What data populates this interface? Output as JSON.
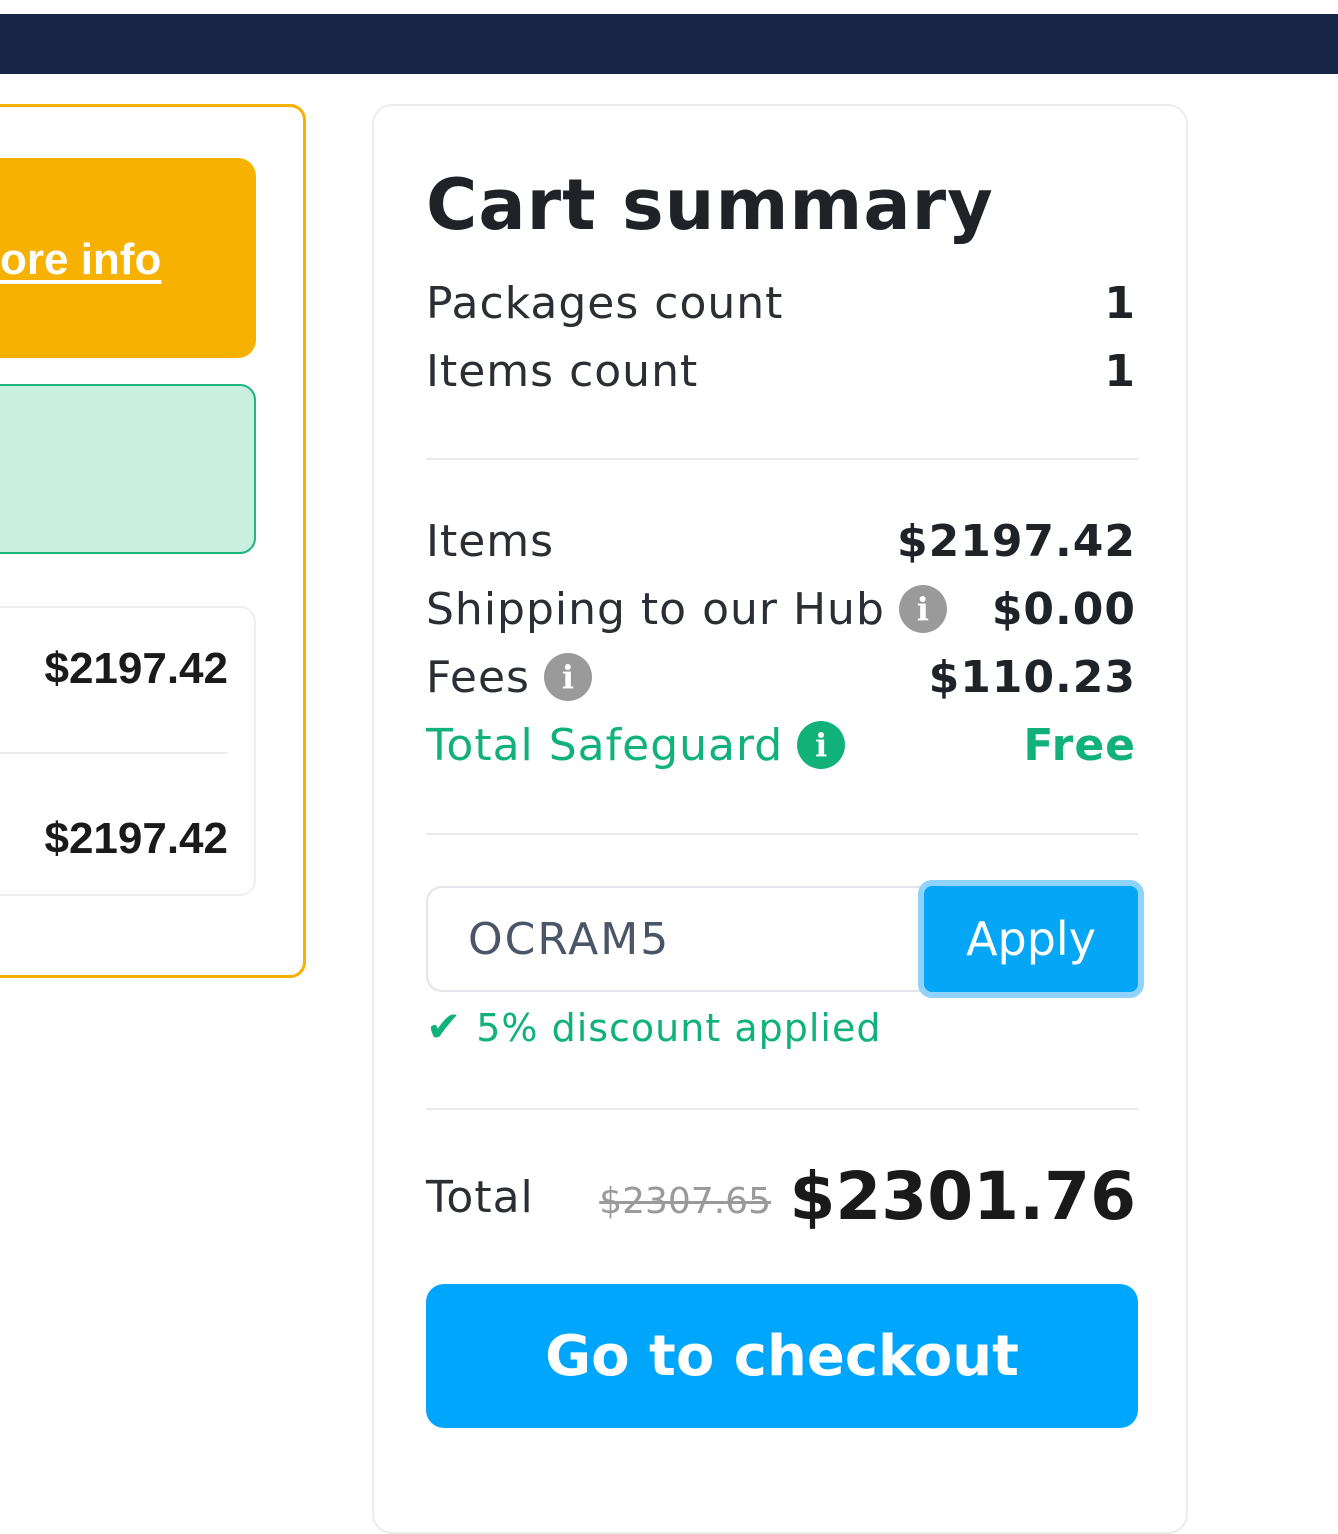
{
  "left_panel": {
    "promo_link": "ore info",
    "prices": [
      "$2197.42",
      "$2197.42"
    ]
  },
  "summary": {
    "title": "Cart summary",
    "packages_count_label": "Packages count",
    "packages_count_value": "1",
    "items_count_label": "Items count",
    "items_count_value": "1",
    "items_label": "Items",
    "items_value": "$2197.42",
    "shipping_label": "Shipping to our Hub",
    "shipping_value": "$0.00",
    "fees_label": "Fees",
    "fees_value": "$110.23",
    "safeguard_label": "Total Safeguard",
    "safeguard_value": "Free",
    "coupon_value": "OCRAM5",
    "apply_label": "Apply",
    "discount_text": "5% discount applied",
    "total_label": "Total",
    "old_total": "$2307.65",
    "new_total": "$2301.76",
    "checkout_label": "Go to checkout"
  },
  "colors": {
    "topbar": "#192546",
    "accent_blue": "#00a6fb",
    "success_green": "#10b27a",
    "promo_yellow": "#f7b100"
  }
}
